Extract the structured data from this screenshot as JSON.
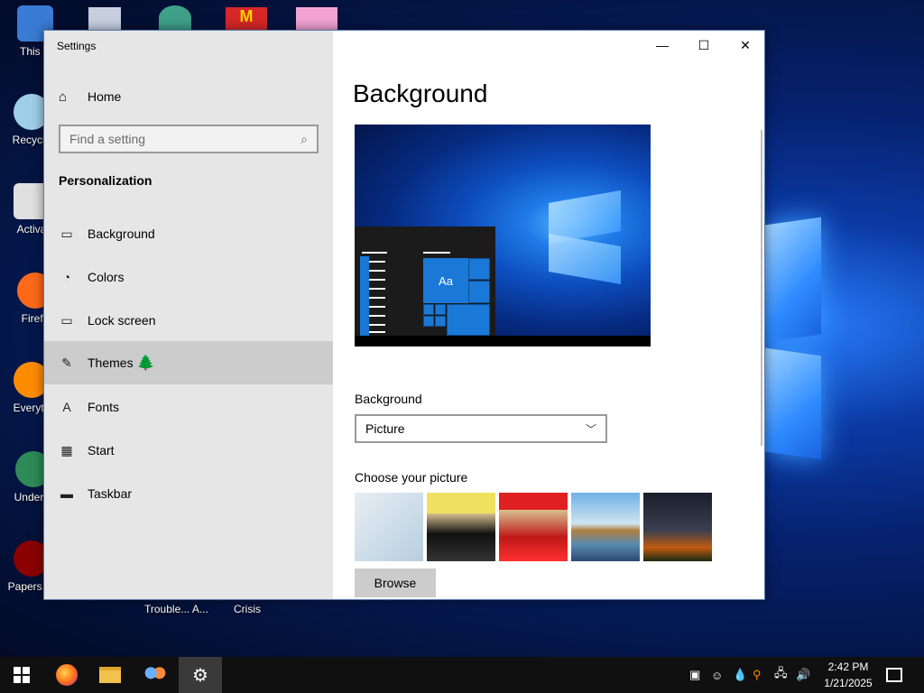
{
  "desktop": {
    "icons": [
      {
        "label": "This P",
        "color": "#3a7bd5"
      },
      {
        "label": "Recycle",
        "color": "#9fcfe8"
      },
      {
        "label": "Activa",
        "color": "#e0e0e0"
      },
      {
        "label": "Firefo",
        "color": "#ff6a1a"
      },
      {
        "label": "Everyth",
        "color": "#ff8c00"
      },
      {
        "label": "Underta",
        "color": "#2e8b57"
      },
      {
        "label": "Papers, P",
        "color": "#8b0000"
      }
    ],
    "bottom_labels": [
      "Trouble... A...",
      "Crisis"
    ]
  },
  "window": {
    "title": "Settings",
    "controls": {
      "minimize": "—",
      "maximize": "☐",
      "close": "✕"
    }
  },
  "nav": {
    "home_label": "Home",
    "search_placeholder": "Find a setting",
    "section_title": "Personalization",
    "items": [
      {
        "label": "Background",
        "icon": "picture-icon"
      },
      {
        "label": "Colors",
        "icon": "palette-icon"
      },
      {
        "label": "Lock screen",
        "icon": "lock-screen-icon"
      },
      {
        "label": "Themes",
        "icon": "themes-icon"
      },
      {
        "label": "Fonts",
        "icon": "fonts-icon"
      },
      {
        "label": "Start",
        "icon": "start-icon"
      },
      {
        "label": "Taskbar",
        "icon": "taskbar-icon"
      }
    ],
    "selected": "Themes",
    "preview_tile_text": "Aa"
  },
  "content": {
    "title": "Background",
    "background_label": "Background",
    "background_value": "Picture",
    "choose_label": "Choose your picture",
    "browse_label": "Browse"
  },
  "taskbar": {
    "time": "2:42 PM",
    "date": "1/21/2025"
  },
  "colors": {
    "accent": "#1a78d6",
    "nav_bg": "#e6e6e6",
    "selected_bg": "#cccccc"
  }
}
